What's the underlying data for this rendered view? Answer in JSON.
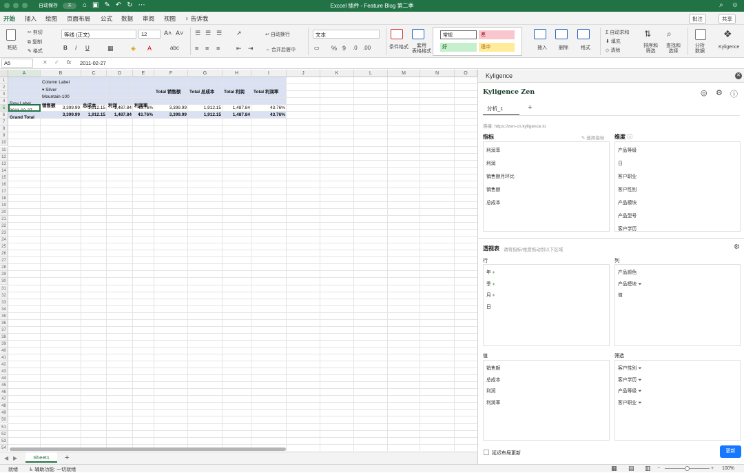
{
  "titlebar": {
    "autosave_label": "自动保存",
    "autosave_state": "关",
    "window_title": "Exccel 插件 - Feature Blog 第二季"
  },
  "tabs": [
    "开始",
    "插入",
    "绘图",
    "页面布局",
    "公式",
    "数据",
    "审阅",
    "视图",
    "告诉我"
  ],
  "tab_actions": {
    "comments": "批注",
    "share": "共享"
  },
  "ribbon": {
    "paste": "粘贴",
    "cut": "剪切",
    "copy": "复制",
    "format_painter": "格式",
    "font_name": "等线 (正文)",
    "font_size": "12",
    "wrap_text": "自动换行",
    "merge_center": "合并后居中",
    "number_format": "文本",
    "conditional_format": "条件格式",
    "table_format": "套用\n表格格式",
    "styles": {
      "normal": "常规",
      "bad": "差",
      "good": "好",
      "neutral": "适中"
    },
    "insert": "插入",
    "delete": "删除",
    "format": "格式",
    "autosum": "自动求和",
    "fill": "填充",
    "clear": "清除",
    "sort_filter": "排序和\n筛选",
    "find_select": "查找和\n选择",
    "analyze_data": "分析\n数据",
    "kyligence": "Kyligence"
  },
  "formula_bar": {
    "name_box": "A5",
    "fx": "fx",
    "value": "2011-02-27"
  },
  "columns": [
    "A",
    "B",
    "C",
    "D",
    "E",
    "F",
    "G",
    "H",
    "I",
    "J",
    "K",
    "L",
    "M",
    "N",
    "O"
  ],
  "pivot": {
    "column_label": "Column Label",
    "silver": "▾ Silver",
    "mountain": "Mountain-100",
    "row_label": "Row Label",
    "headers": [
      "销售额",
      "总成本",
      "利润",
      "利润率",
      "Total 销售额",
      "Total 总成本",
      "Total 利润",
      "Total 利润率"
    ],
    "row": {
      "label": "2011-02-27",
      "values": [
        "3,399.99",
        "1,912.15",
        "1,487.84",
        "43.76%",
        "3,399.99",
        "1,912.15",
        "1,487.84",
        "43.76%"
      ]
    },
    "grand": {
      "label": "Grand Total",
      "values": [
        "3,399.99",
        "1,912.15",
        "1,487.84",
        "43.76%",
        "3,399.99",
        "1,912.15",
        "1,487.84",
        "43.76%"
      ]
    }
  },
  "sheet_tab": "Sheet1",
  "status": {
    "ready": "就绪",
    "accessibility": "辅助功能: 一切就绪",
    "zoom": "100%"
  },
  "pane": {
    "title": "Kyligence",
    "brand": "Kyligence Zen",
    "tab": "分析_1",
    "connection": "连接: https://zen-cn.kyligence.io",
    "metrics_title": "指标",
    "select_metrics": "选择指标",
    "metrics": [
      "利润率",
      "利润",
      "销售额月环比",
      "销售额",
      "总成本"
    ],
    "dims_title": "维度",
    "dims": [
      "产品等级",
      "日",
      "客户职业",
      "客户性别",
      "产品模块",
      "产品型号",
      "客户学历"
    ],
    "pivot_title": "透视表",
    "pivot_hint": "请将指标/维度拖动到以下区域",
    "rows_title": "行",
    "rows": [
      "年",
      "季",
      "月",
      "日"
    ],
    "cols_title": "列",
    "cols": [
      "产品颜色",
      "产品模块",
      "值"
    ],
    "values_title": "值",
    "values": [
      "销售额",
      "总成本",
      "利润",
      "利润率"
    ],
    "filters_title": "筛选",
    "filters": [
      "客户性别",
      "客户学历",
      "产品等级",
      "客户职业"
    ],
    "defer_label": "延迟布局更新",
    "update_button": "更新"
  },
  "colors": {
    "excel_green": "#217346",
    "pivot_fill": "#d9e1f2",
    "update_blue": "#1677ff"
  }
}
